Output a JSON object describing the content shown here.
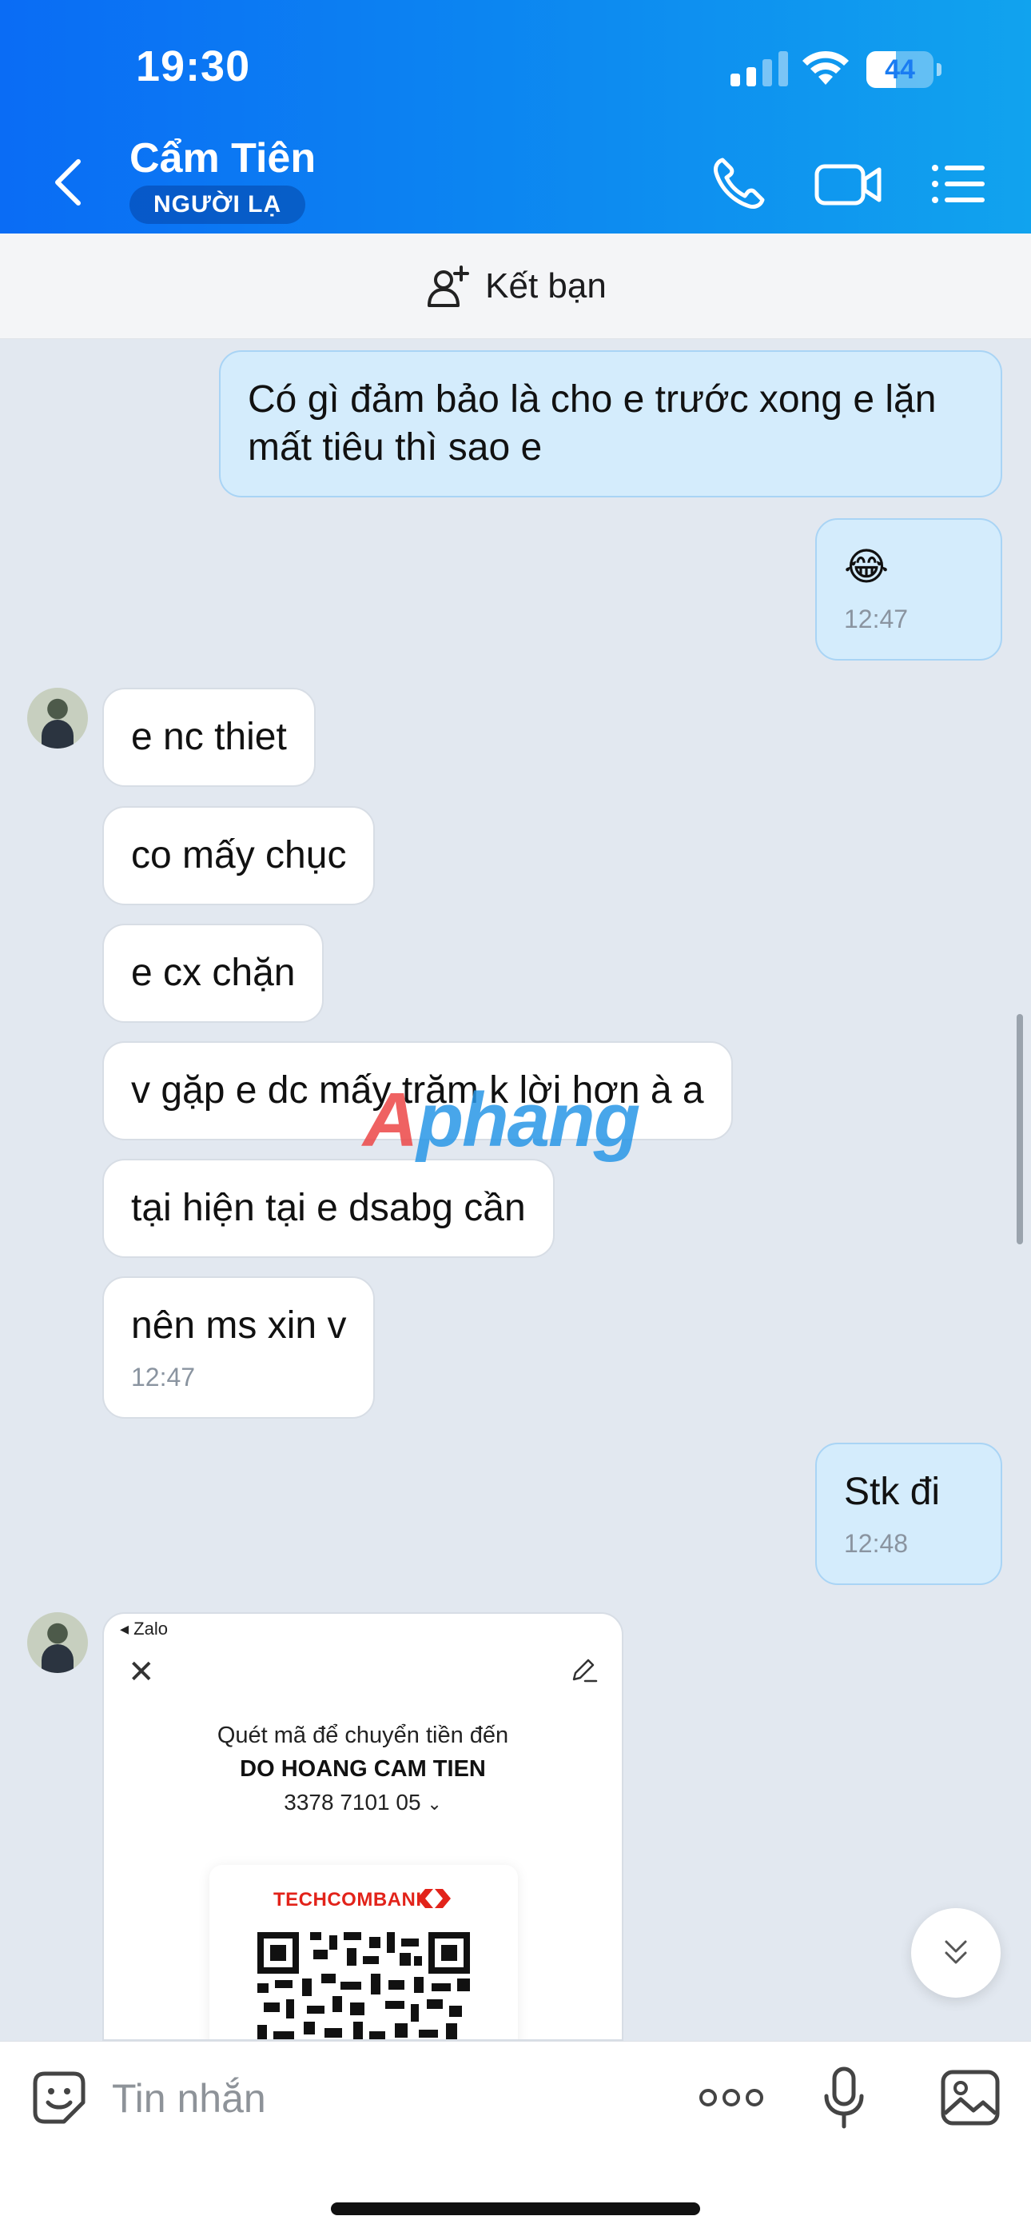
{
  "status_bar": {
    "time": "19:30",
    "battery": "44",
    "battery_level": 0.44
  },
  "header": {
    "contact_name": "Cẩm Tiên",
    "badge": "NGƯỜI LẠ"
  },
  "add_friend": {
    "label": "Kết bạn"
  },
  "messages": [
    {
      "dir": "out",
      "text": "Có gì đảm bảo là cho e trước xong e lặn mất tiêu thì sao e"
    },
    {
      "dir": "out",
      "text": "😂",
      "time": "12:47"
    },
    {
      "dir": "in",
      "text": "e nc thiet"
    },
    {
      "dir": "in",
      "text": "co mấy chục"
    },
    {
      "dir": "in",
      "text": "e cx chặn"
    },
    {
      "dir": "in",
      "text": "v gặp e dc mấy trăm k lời hơn à a"
    },
    {
      "dir": "in",
      "text": "tại hiện tại e dsabg cần"
    },
    {
      "dir": "in",
      "text": "nên ms xin v",
      "time": "12:47"
    },
    {
      "dir": "out",
      "text": "Stk đi",
      "time": "12:48"
    }
  ],
  "qr_card": {
    "app_label": "◂ Zalo",
    "close": "✕",
    "title": "Quét mã để chuyển tiền đến",
    "name": "DO HOANG CAM TIEN",
    "account": "3378 7101 05",
    "bank": "TECHCOMBANK"
  },
  "watermark": {
    "part1": "A",
    "part2": "phang"
  },
  "input": {
    "placeholder": "Tin nhắn"
  },
  "icons": {
    "back": "chevron-left-icon",
    "call": "phone-icon",
    "video": "video-camera-icon",
    "menu": "list-menu-icon",
    "add_friend": "add-user-icon",
    "sticker": "sticker-icon",
    "more": "more-dots-icon",
    "mic": "microphone-icon",
    "image": "image-icon",
    "scroll_down": "chevron-double-down-icon"
  },
  "colors": {
    "header": "#0a6cf5",
    "outgoing_bubble": "#d4ecfc",
    "incoming_bubble": "#ffffff",
    "background": "#e2e8f0"
  }
}
